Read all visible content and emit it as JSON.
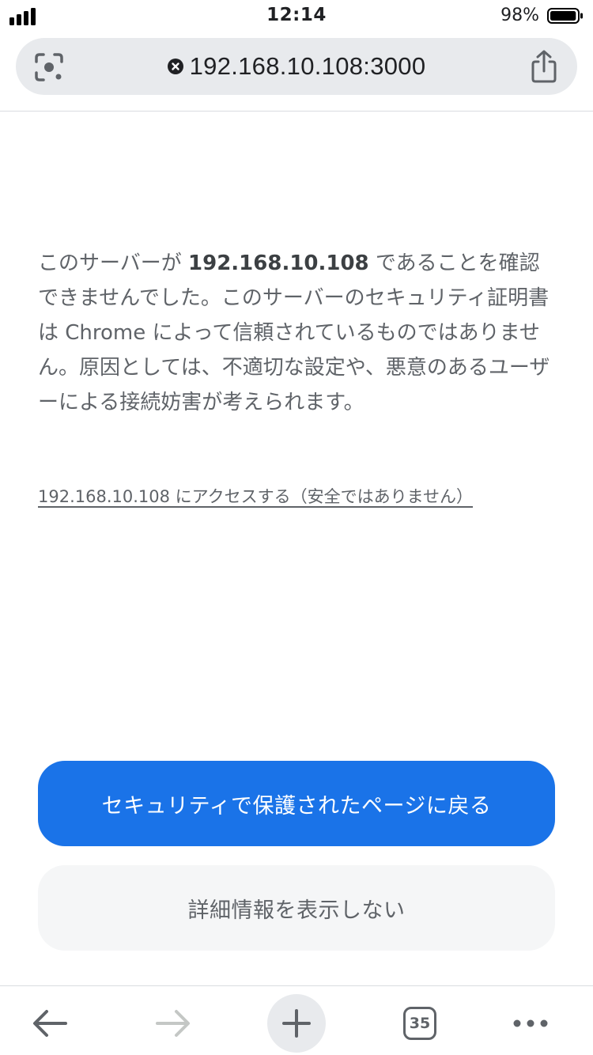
{
  "status_bar": {
    "time": "12:14",
    "battery_percent": "98%",
    "battery_level": 0.98
  },
  "address_bar": {
    "url": "192.168.10.108:3000",
    "icons": [
      "lens-icon",
      "not-secure-icon",
      "share-icon"
    ]
  },
  "interstitial": {
    "message_part1": "このサーバーが ",
    "message_host": "192.168.10.108",
    "message_part2": " であることを確認できませんでした。このサーバーのセキュリティ証明書は Chrome によって信頼されているものではありません。原因としては、不適切な設定や、悪意のあるユーザーによる接続妨害が考えられます。",
    "proceed_link": "192.168.10.108 にアクセスする（安全ではありません）",
    "back_button": "セキュリティで保護されたページに戻る",
    "details_button": "詳細情報を表示しない"
  },
  "toolbar": {
    "tab_count": "35",
    "icons": [
      "back-arrow-icon",
      "forward-arrow-icon",
      "plus-icon",
      "tabs-icon",
      "more-dots-icon"
    ]
  },
  "colors": {
    "accent": "#1a73e8",
    "text_secondary": "#5f6368",
    "omnibox_bg": "#e8eaed",
    "secondary_button_bg": "#f5f6f7"
  }
}
